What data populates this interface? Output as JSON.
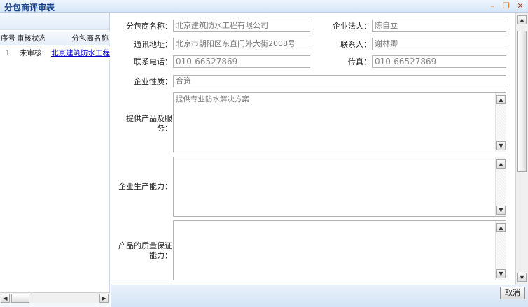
{
  "window": {
    "title": "分包商评审表",
    "min_icon": "minimize-icon",
    "max_icon": "maximize-icon",
    "close_icon": "close-icon"
  },
  "grid": {
    "headers": {
      "seq": "序号",
      "status": "审核状态",
      "name": "分包商名称"
    },
    "rows": [
      {
        "seq": "1",
        "status": "未审核",
        "name": "北京建筑防水工程有限公司"
      }
    ]
  },
  "form": {
    "company_name": {
      "label": "分包商名称：",
      "value": "北京建筑防水工程有限公司"
    },
    "legal_person": {
      "label": "企业法人：",
      "value": "陈自立"
    },
    "address": {
      "label": "通讯地址：",
      "value": "北京市朝阳区东直门外大街2008号"
    },
    "contact": {
      "label": "联系人：",
      "value": "谢林卿"
    },
    "phone": {
      "label": "联系电话：",
      "value": "010-66527869"
    },
    "fax": {
      "label": "传真：",
      "value": "010-66527869"
    },
    "nature": {
      "label": "企业性质：",
      "value": "合资"
    },
    "products": {
      "label": "提供产品及服务：",
      "value": "提供专业防水解决方案"
    },
    "capacity": {
      "label": "企业生产能力：",
      "value": ""
    },
    "quality": {
      "label": "产品的质量保证能力：",
      "value": ""
    }
  },
  "footer": {
    "cancel_label": "取消"
  },
  "scroll_icons": {
    "left": "◀",
    "right": "▶",
    "up": "▲",
    "down": "▼"
  }
}
